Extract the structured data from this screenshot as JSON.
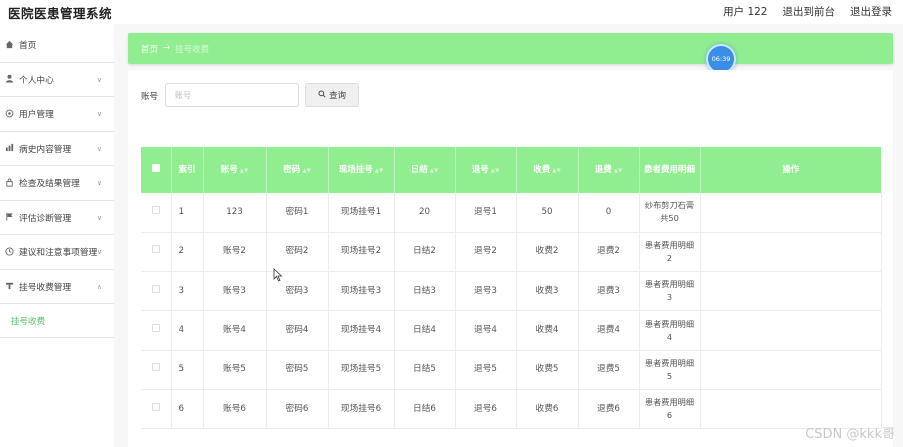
{
  "header": {
    "app_title": "医院医患管理系统",
    "user_label": "用户 122",
    "front_link": "退出到前台",
    "logout_link": "退出登录"
  },
  "sidebar": {
    "items": [
      {
        "label": "首页",
        "icon": "home-icon",
        "expanded": false,
        "has_chevron": false
      },
      {
        "label": "个人中心",
        "icon": "person-icon",
        "has_chevron": true
      },
      {
        "label": "用户管理",
        "icon": "user-gear-icon",
        "has_chevron": true
      },
      {
        "label": "病史内容管理",
        "icon": "chart-icon",
        "has_chevron": true
      },
      {
        "label": "检查及结果管理",
        "icon": "lock-icon",
        "has_chevron": true
      },
      {
        "label": "评估诊断管理",
        "icon": "flag-icon",
        "has_chevron": true
      },
      {
        "label": "建议和注意事项管理",
        "icon": "clock-icon",
        "has_chevron": true
      },
      {
        "label": "挂号收费管理",
        "icon": "payment-icon",
        "has_chevron": true,
        "expanded": true
      }
    ],
    "submenu": {
      "label": "挂号收费"
    }
  },
  "breadcrumb": {
    "home": "首页",
    "arrow": "→",
    "current": "挂号收费"
  },
  "clock": {
    "time": "06:39"
  },
  "search": {
    "label": "账号",
    "placeholder": "账号",
    "button_label": "查询"
  },
  "table": {
    "headers": {
      "index": "索引",
      "account": "账号",
      "password": "密码",
      "scene_reg": "现场挂号",
      "daily_settle": "日结",
      "reg_number": "退号",
      "fee": "收费",
      "refund": "退费",
      "detail": "患者费用明细",
      "actions": "操作"
    },
    "rows": [
      {
        "index": "1",
        "account": "123",
        "password": "密码1",
        "scene_reg": "现场挂号1",
        "daily_settle": "20",
        "reg_number": "退号1",
        "fee": "50",
        "refund": "0",
        "detail": "纱布剪刀石膏共50"
      },
      {
        "index": "2",
        "account": "账号2",
        "password": "密码2",
        "scene_reg": "现场挂号2",
        "daily_settle": "日结2",
        "reg_number": "退号2",
        "fee": "收费2",
        "refund": "退费2",
        "detail": "患者费用明细2"
      },
      {
        "index": "3",
        "account": "账号3",
        "password": "密码3",
        "scene_reg": "现场挂号3",
        "daily_settle": "日结3",
        "reg_number": "退号3",
        "fee": "收费3",
        "refund": "退费3",
        "detail": "患者费用明细3"
      },
      {
        "index": "4",
        "account": "账号4",
        "password": "密码4",
        "scene_reg": "现场挂号4",
        "daily_settle": "日结4",
        "reg_number": "退号4",
        "fee": "收费4",
        "refund": "退费4",
        "detail": "患者费用明细4"
      },
      {
        "index": "5",
        "account": "账号5",
        "password": "密码5",
        "scene_reg": "现场挂号5",
        "daily_settle": "日结5",
        "reg_number": "退号5",
        "fee": "收费5",
        "refund": "退费5",
        "detail": "患者费用明细5"
      },
      {
        "index": "6",
        "account": "账号6",
        "password": "密码6",
        "scene_reg": "现场挂号6",
        "daily_settle": "日结6",
        "reg_number": "退号6",
        "fee": "收费6",
        "refund": "退费6",
        "detail": "患者费用明细6"
      }
    ]
  },
  "watermark": "CSDN @kkk哥",
  "colors": {
    "accent": "#90ee90",
    "active_submenu": "#57c06a",
    "clock": "#3a8ee6"
  }
}
